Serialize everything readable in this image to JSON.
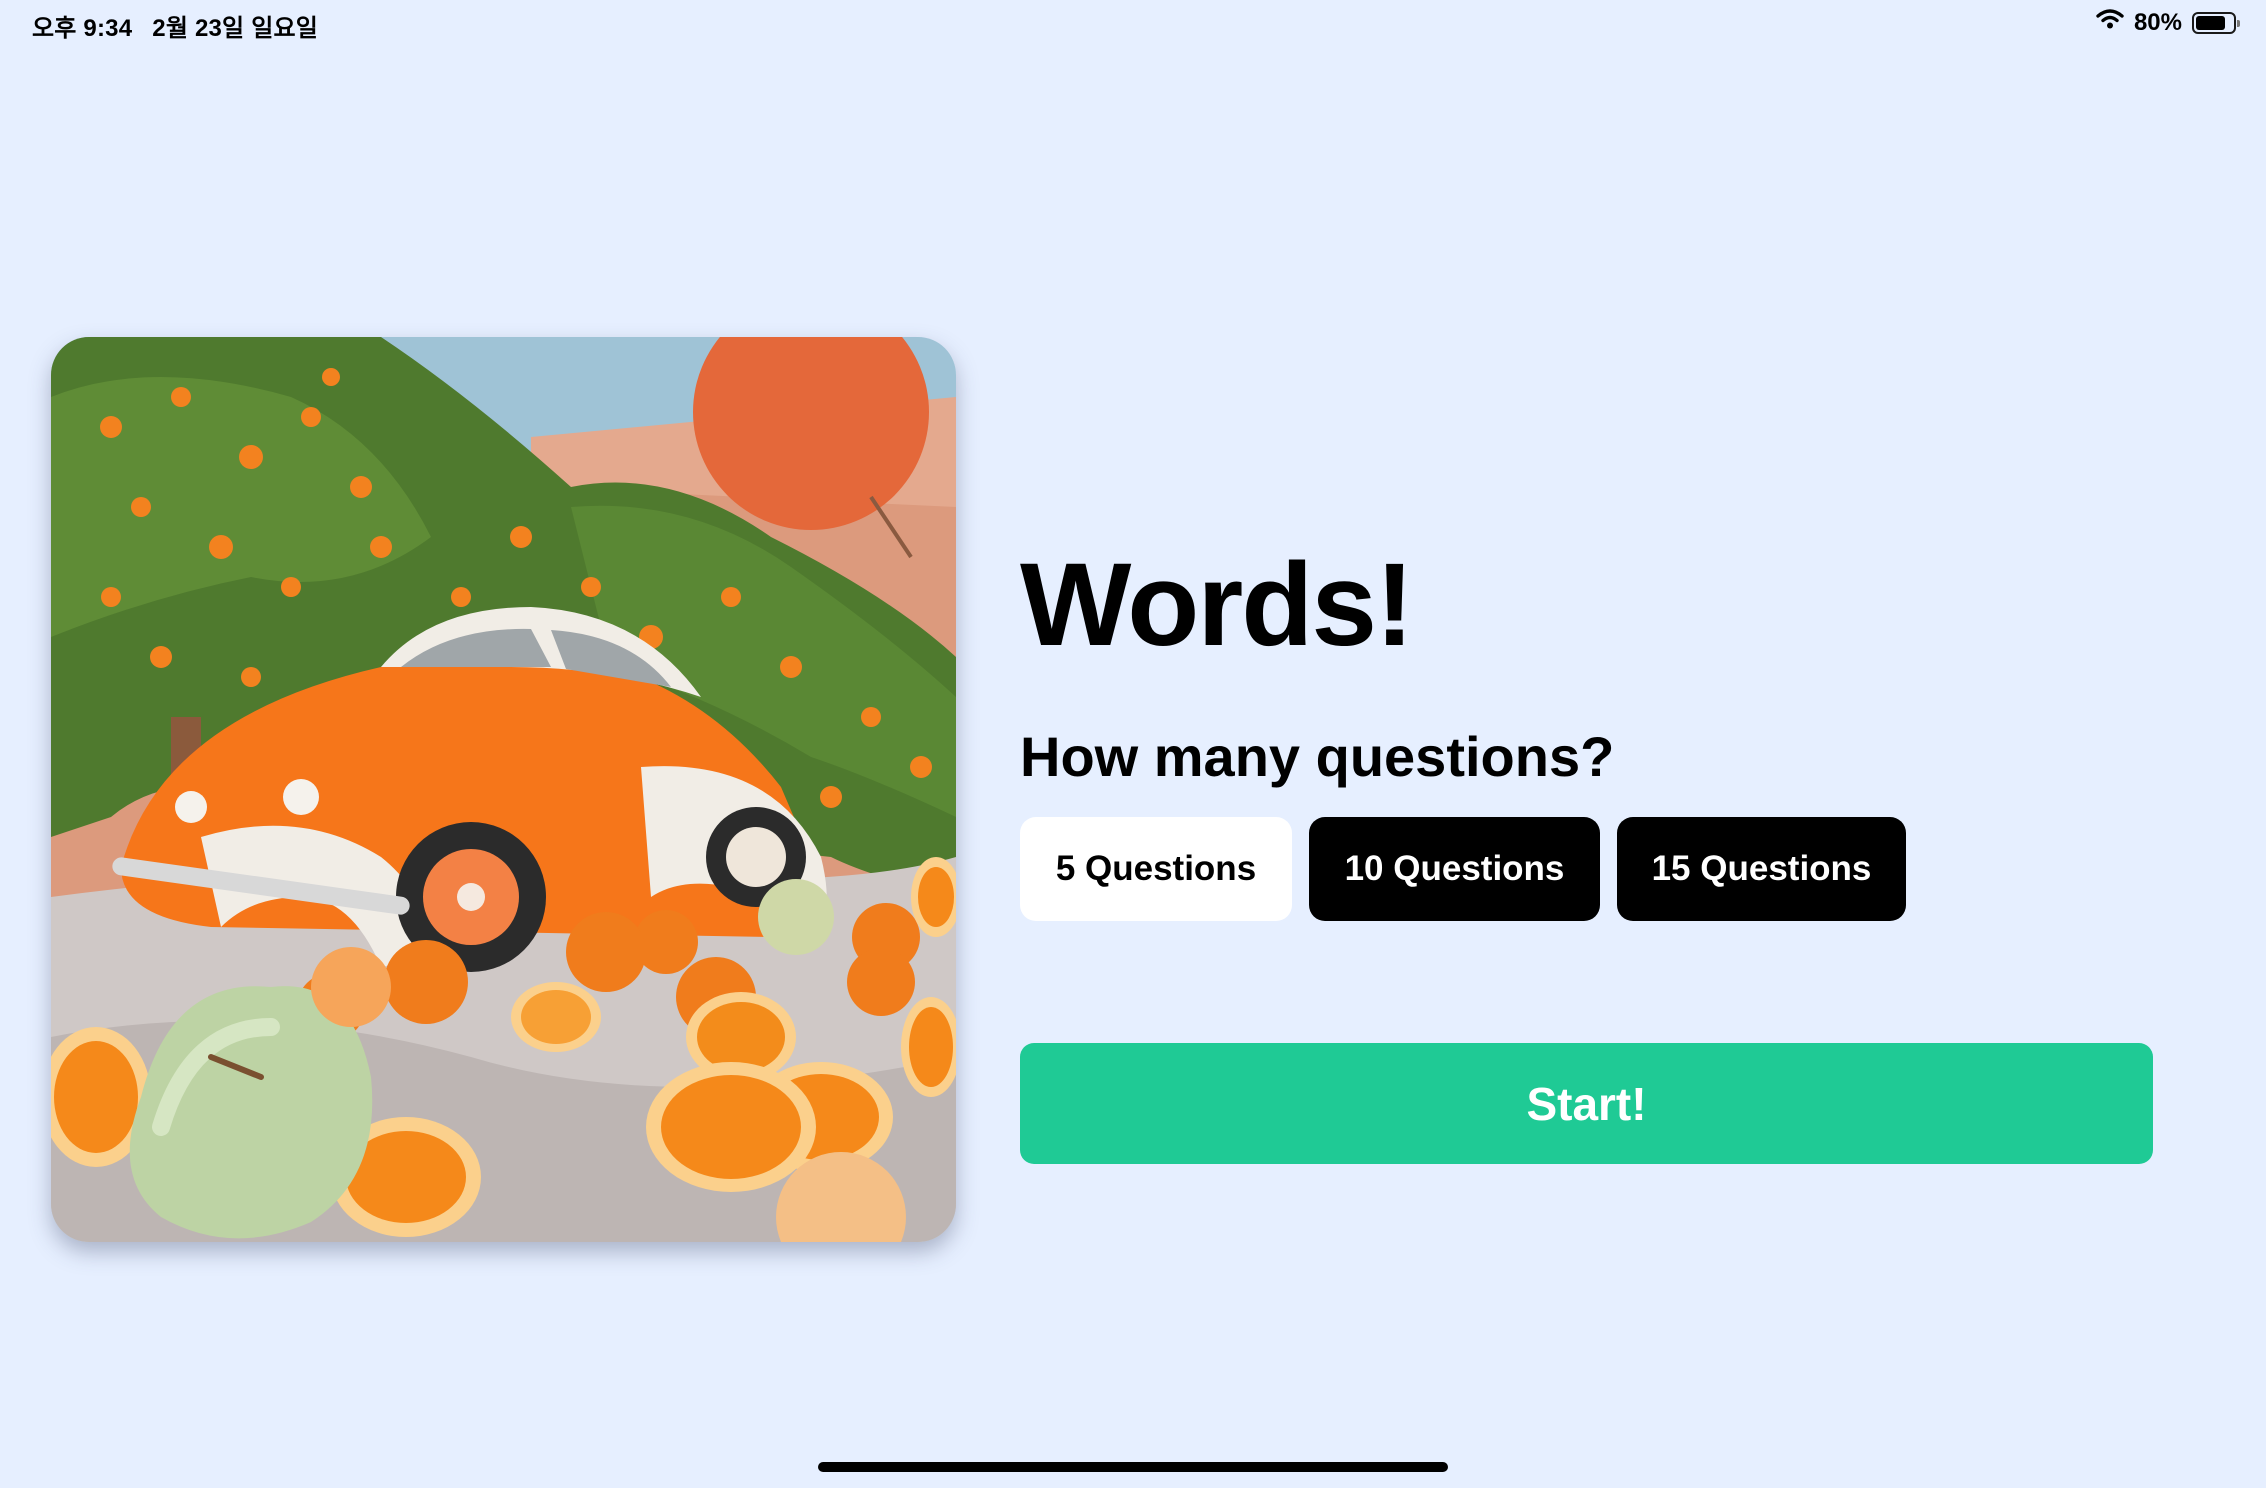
{
  "status_bar": {
    "time": "오후 9:34",
    "date": "2월 23일 일요일",
    "battery_percent": "80%",
    "battery_level": 0.8,
    "wifi_icon": "wifi-icon",
    "battery_icon": "battery-icon"
  },
  "hero_image": {
    "icon": "orange-car-illustration"
  },
  "main": {
    "title": "Words!",
    "question_prompt": "How many questions?",
    "options": [
      {
        "label": "5 Questions",
        "selected": true
      },
      {
        "label": "10 Questions",
        "selected": false
      },
      {
        "label": "15 Questions",
        "selected": false
      }
    ],
    "start_label": "Start!"
  },
  "colors": {
    "background": "#e6efff",
    "start_button": "#1fca95",
    "selected_option": "#ffffff",
    "unselected_option": "#000000"
  }
}
